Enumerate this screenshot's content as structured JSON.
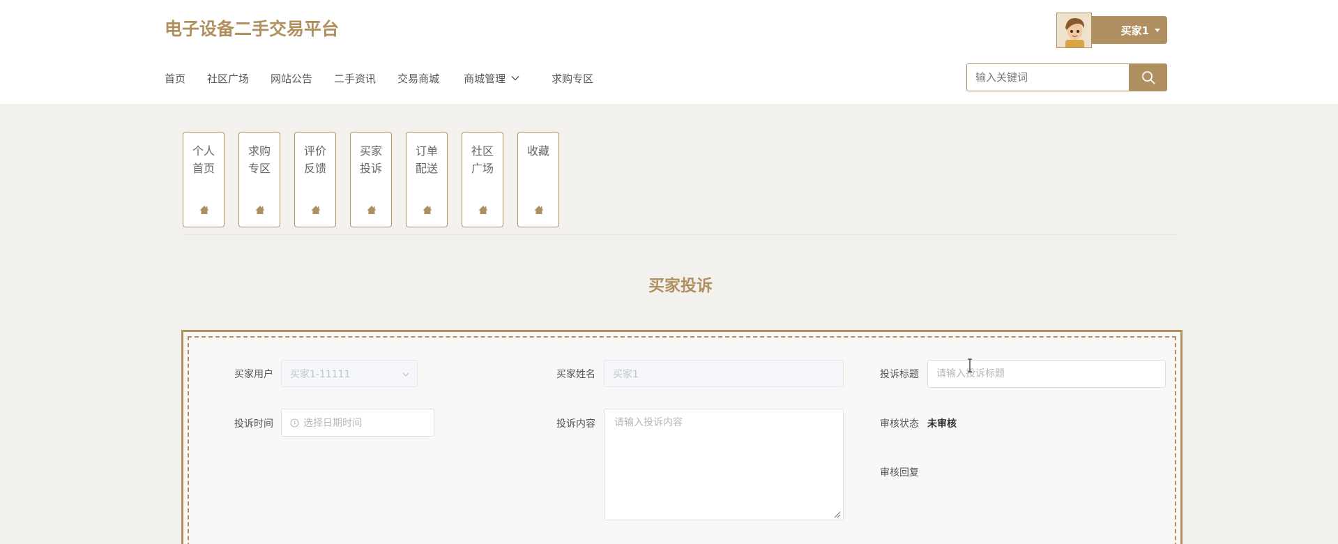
{
  "header": {
    "site_title": "电子设备二手交易平台",
    "nav": [
      {
        "label": "首页"
      },
      {
        "label": "社区广场"
      },
      {
        "label": "网站公告"
      },
      {
        "label": "二手资讯"
      },
      {
        "label": "交易商城"
      },
      {
        "label": "商城管理",
        "has_dropdown": true
      },
      {
        "label": "求购专区"
      }
    ],
    "user": {
      "name": "买家1"
    },
    "search": {
      "placeholder": "输入关键词",
      "icon": "search-icon"
    }
  },
  "tiles": [
    {
      "label": "个人首页",
      "icon": "home-icon"
    },
    {
      "label": "求购专区",
      "icon": "home-icon"
    },
    {
      "label": "评价反馈",
      "icon": "home-icon"
    },
    {
      "label": "买家投诉",
      "icon": "home-icon"
    },
    {
      "label": "订单配送",
      "icon": "home-icon"
    },
    {
      "label": "社区广场",
      "icon": "home-icon"
    },
    {
      "label": "收藏",
      "icon": "home-icon"
    }
  ],
  "page_title": "买家投诉",
  "form": {
    "buyer_user": {
      "label": "买家用户",
      "value": "买家1-11111"
    },
    "buyer_name": {
      "label": "买家姓名",
      "value": "买家1"
    },
    "complaint_title": {
      "label": "投诉标题",
      "placeholder": "请输入投诉标题"
    },
    "complaint_time": {
      "label": "投诉时间",
      "placeholder": "选择日期时间"
    },
    "complaint_content": {
      "label": "投诉内容",
      "placeholder": "请输入投诉内容"
    },
    "review_status": {
      "label": "审核状态",
      "value": "未审核"
    },
    "review_reply": {
      "label": "审核回复"
    }
  },
  "colors": {
    "accent": "#b09060",
    "background": "#f3f1ed"
  }
}
